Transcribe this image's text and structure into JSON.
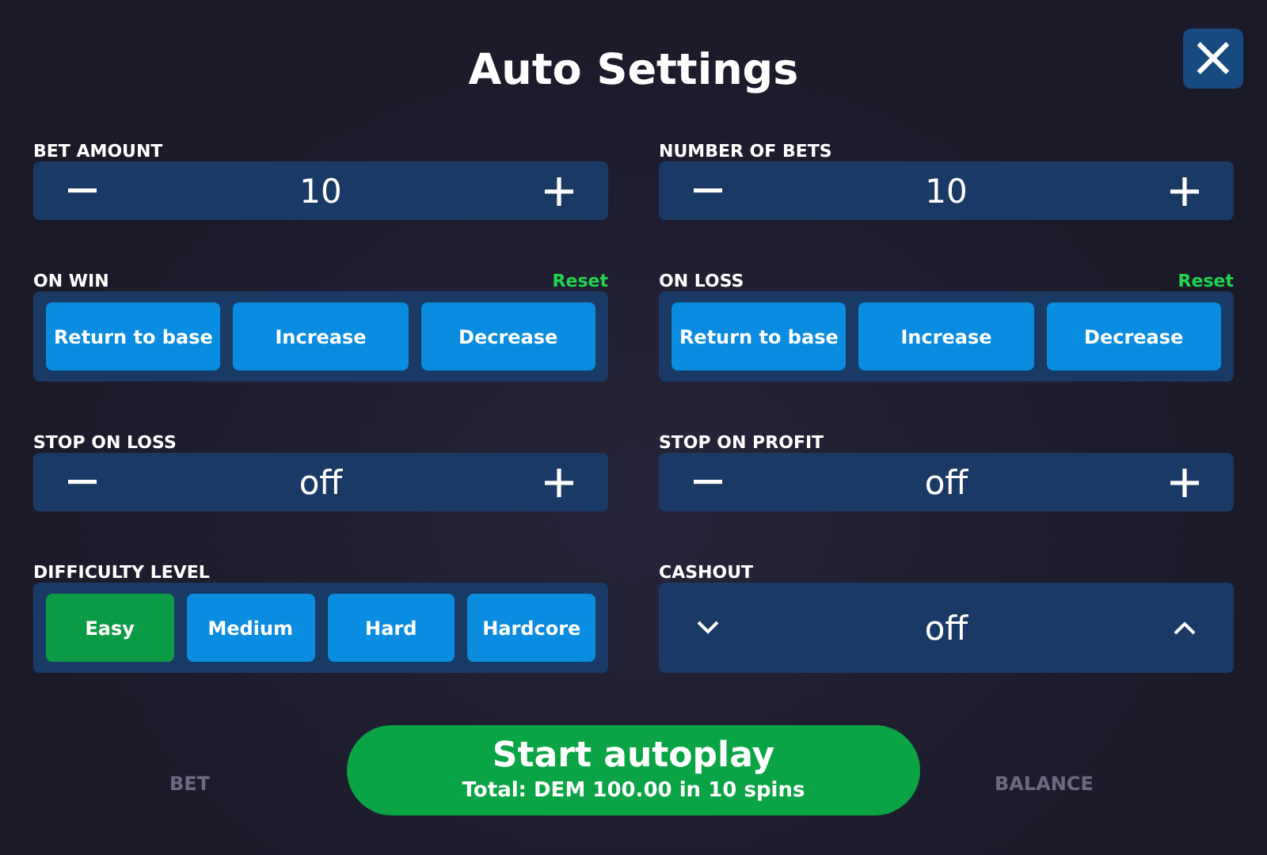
{
  "title": "Auto Settings",
  "close": {
    "label": "×"
  },
  "settings": [
    {
      "kind": "stepper",
      "label": "BET AMOUNT",
      "value": "10"
    },
    {
      "kind": "stepper",
      "label": "NUMBER OF BETS",
      "value": "10"
    },
    {
      "kind": "options",
      "label": "ON WIN",
      "reset": "Reset",
      "options": [
        {
          "label": "Return to base",
          "selected": false
        },
        {
          "label": "Increase",
          "selected": false
        },
        {
          "label": "Decrease",
          "selected": false
        }
      ]
    },
    {
      "kind": "options",
      "label": "ON LOSS",
      "reset": "Reset",
      "options": [
        {
          "label": "Return to base",
          "selected": false
        },
        {
          "label": "Increase",
          "selected": false
        },
        {
          "label": "Decrease",
          "selected": false
        }
      ]
    },
    {
      "kind": "stepper",
      "label": "STOP ON LOSS",
      "value": "off"
    },
    {
      "kind": "stepper",
      "label": "STOP ON PROFIT",
      "value": "off"
    },
    {
      "kind": "options",
      "label": "DIFFICULTY LEVEL",
      "options": [
        {
          "label": "Easy",
          "selected": true
        },
        {
          "label": "Medium",
          "selected": false
        },
        {
          "label": "Hard",
          "selected": false
        },
        {
          "label": "Hardcore",
          "selected": false
        }
      ]
    },
    {
      "kind": "select",
      "label": "CASHOUT",
      "value": "off"
    }
  ],
  "background_labels": [
    "BET",
    "BALANCE"
  ],
  "start": {
    "title": "Start autoplay",
    "subtitle": "Total: DEM 100.00 in 10 spins"
  }
}
